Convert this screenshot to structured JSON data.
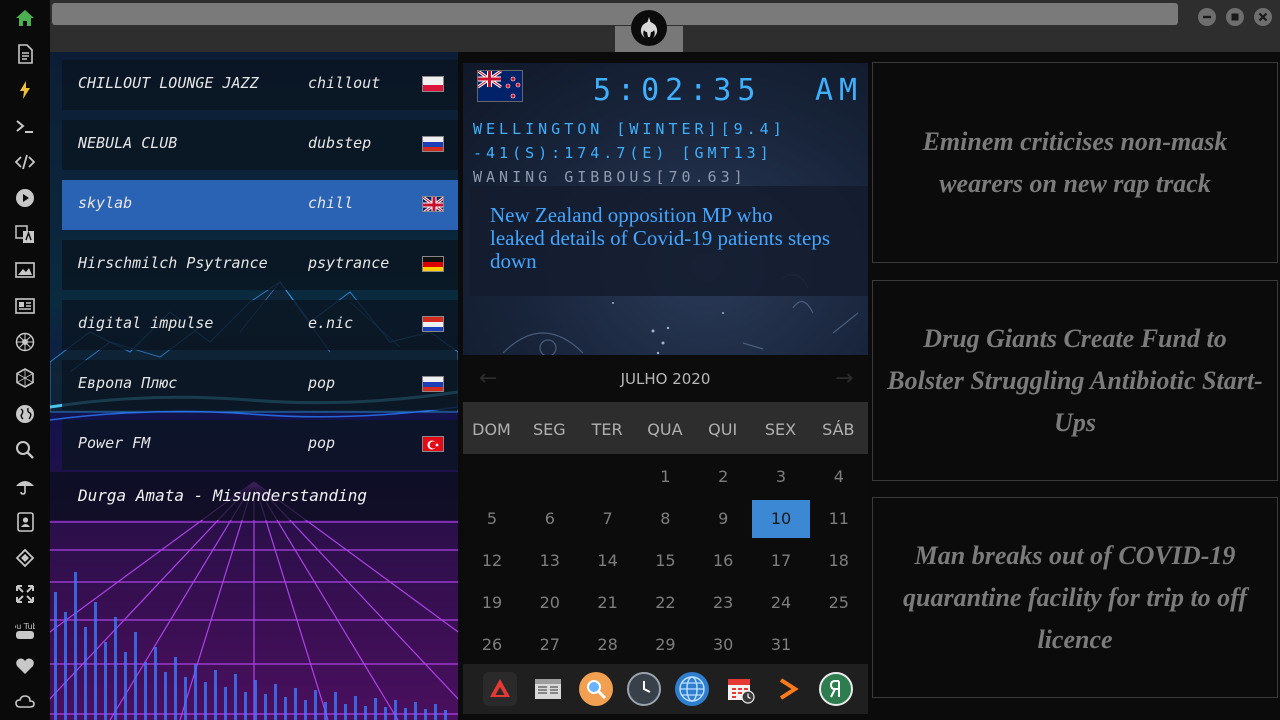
{
  "rail": {
    "icons": [
      "home-icon",
      "document-icon",
      "lightning-icon",
      "terminal-icon",
      "code-icon",
      "play-icon",
      "translate-icon",
      "image-icon",
      "news-icon",
      "rebel-icon",
      "hexagon-icon",
      "globe-icon",
      "search-icon",
      "umbrella-icon",
      "contacts-icon",
      "tags-icon",
      "expand-icon",
      "youtube-icon",
      "heart-icon",
      "cloud-icon"
    ],
    "active_color": "#4caf50",
    "icon_color": "#c8c8c8",
    "youtube_label": "You Tube"
  },
  "radio": {
    "stations": [
      {
        "name": "CHILLOUT LOUNGE JAZZ",
        "genre": "chillout",
        "flag": "poland"
      },
      {
        "name": "NEBULA CLUB",
        "genre": "dubstep",
        "flag": "russia"
      },
      {
        "name": "skylab",
        "genre": "chill",
        "flag": "uk"
      },
      {
        "name": "Hirschmilch Psytrance",
        "genre": "psytrance",
        "flag": "germany"
      },
      {
        "name": "digital impulse",
        "genre": "e.nic",
        "flag": "croatia"
      },
      {
        "name": "Европа Плюс",
        "genre": "pop",
        "flag": "russia"
      },
      {
        "name": "Power FM",
        "genre": "pop",
        "flag": "turkey"
      }
    ],
    "selected_index": 2,
    "now_playing": "Durga Amata - Misunderstanding",
    "accent": "#2a62b4"
  },
  "clock": {
    "time": "5:02:35",
    "ampm": "AM",
    "location_line": "WELLINGTON [WINTER][9.4]",
    "coords_line": "-41(S):174.7(E) [GMT13]",
    "moon_line": "WANING GIBBOUS[70.63]",
    "headline": "New Zealand opposition MP who leaked details of Covid-19 patients steps down",
    "digit_color": "#3fb0ff"
  },
  "calendar": {
    "title": "JULHO 2020",
    "weekdays": [
      "DOM",
      "SEG",
      "TER",
      "QUA",
      "QUI",
      "SEX",
      "SÁB"
    ],
    "weeks": [
      [
        "",
        "",
        "",
        "1",
        "2",
        "3",
        "4"
      ],
      [
        "5",
        "6",
        "7",
        "8",
        "9",
        "10",
        "11"
      ],
      [
        "12",
        "13",
        "14",
        "15",
        "16",
        "17",
        "18"
      ],
      [
        "19",
        "20",
        "21",
        "22",
        "23",
        "24",
        "25"
      ],
      [
        "26",
        "27",
        "28",
        "29",
        "30",
        "31",
        ""
      ]
    ],
    "today": "10",
    "prev_label": "←",
    "next_label": "→",
    "today_color": "#3d88d4"
  },
  "dock": {
    "apps": [
      "anydesk-icon",
      "news-reader-icon",
      "search-app-icon",
      "clock-app-icon",
      "browser-globe-icon",
      "calendar-app-icon",
      "media-play-icon",
      "yandex-icon"
    ]
  },
  "news": [
    "Eminem criticises non-mask wearers on new rap track",
    "Drug Giants Create Fund to Bolster Struggling Antibiotic Start-Ups",
    "Man breaks out of COVID-19 quarantine facility for trip to off licence"
  ]
}
